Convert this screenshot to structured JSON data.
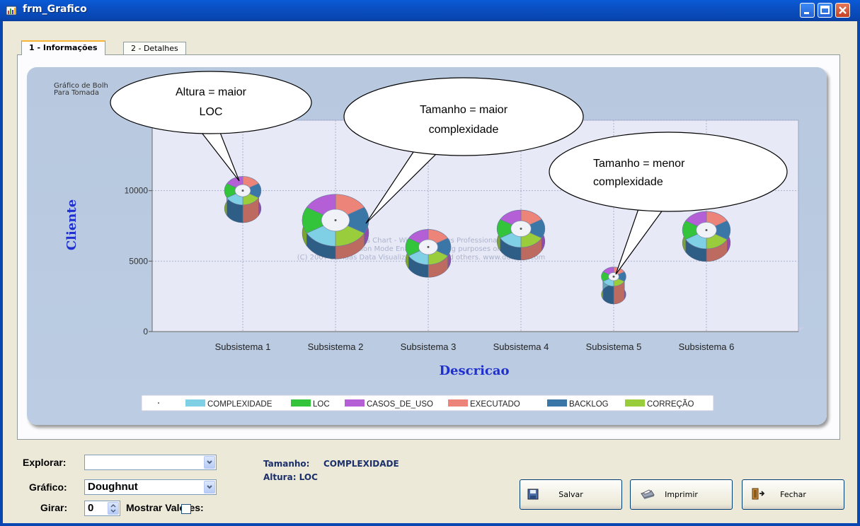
{
  "window": {
    "title": "frm_Grafico"
  },
  "tabs": [
    {
      "label": "1 - Informações",
      "active": true
    },
    {
      "label": "2 - Detalhes",
      "active": false
    }
  ],
  "chart": {
    "subtitle_lines": [
      "Gráfico de Bolh",
      "Para Tomada"
    ],
    "watermark_lines": [
      "Dundas Chart - Windows Forms Professional",
      "Evaluation Mode Enabled - testing purposes only",
      "(C) 2007 Dundas Data Visualization Inc. and others. www.dundas.com"
    ],
    "callouts": [
      {
        "text_lines": [
          "Altura = maior",
          "LOC"
        ]
      },
      {
        "text_lines": [
          "Tamanho = maior",
          "complexidade"
        ]
      },
      {
        "text_lines": [
          "Tamanho = menor",
          "complexidade"
        ]
      }
    ]
  },
  "chart_data": {
    "type": "scatter",
    "subtype": "bubble-doughnut",
    "xlabel": "Descricao",
    "ylabel": "Cliente",
    "categories": [
      "Subsistema 1",
      "Subsistema 2",
      "Subsistema 3",
      "Subsistema 4",
      "Subsistema 5",
      "Subsistema 6"
    ],
    "yticks": [
      0,
      5000,
      10000
    ],
    "ylim": [
      0,
      15000
    ],
    "points": [
      {
        "x": "Subsistema 1",
        "y": 10000,
        "size": 0.55
      },
      {
        "x": "Subsistema 2",
        "y": 7900,
        "size": 1.0
      },
      {
        "x": "Subsistema 3",
        "y": 6000,
        "size": 0.68
      },
      {
        "x": "Subsistema 4",
        "y": 7300,
        "size": 0.72
      },
      {
        "x": "Subsistema 5",
        "y": 3900,
        "size": 0.37
      },
      {
        "x": "Subsistema 6",
        "y": 7200,
        "size": 0.72
      }
    ],
    "legend": [
      {
        "name": "COMPLEXIDADE",
        "color": "#7fd0e4"
      },
      {
        "name": "LOC",
        "color": "#33c43c"
      },
      {
        "name": "CASOS_DE_USO",
        "color": "#b45fd6"
      },
      {
        "name": "EXECUTADO",
        "color": "#ec8479"
      },
      {
        "name": "BACKLOG",
        "color": "#3a76a6"
      },
      {
        "name": "CORREÇÃO",
        "color": "#9acd3c"
      }
    ],
    "legend_position": "bottom",
    "grid": true
  },
  "controls": {
    "explorar_label": "Explorar:",
    "explorar_value": "",
    "grafico_label": "Gráfico:",
    "grafico_value": "Doughnut",
    "girar_label": "Girar:",
    "girar_value": "0",
    "mostrar_valores_label": "Mostrar Valores:",
    "mostrar_valores_checked": false,
    "tamanho_label": "Tamanho:",
    "tamanho_value": "COMPLEXIDADE",
    "altura_label": "Altura: LOC"
  },
  "buttons": {
    "salvar": "Salvar",
    "imprimir": "Imprimir",
    "fechar": "Fechar"
  }
}
